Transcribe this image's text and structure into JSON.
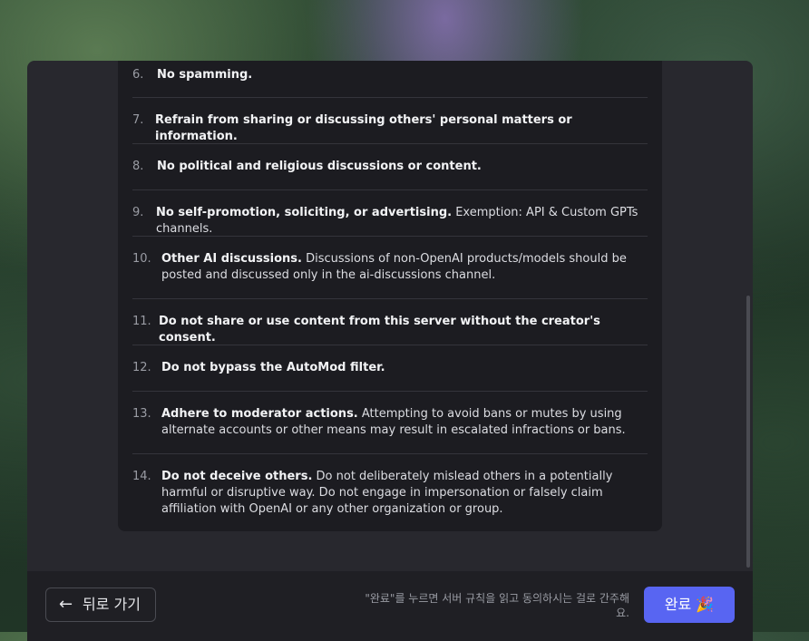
{
  "rules": [
    {
      "number": "6.",
      "title": "No spamming.",
      "body": ""
    },
    {
      "number": "7.",
      "title": "Refrain from sharing or discussing others' personal matters or information.",
      "body": ""
    },
    {
      "number": "8.",
      "title": "No political and religious discussions or content.",
      "body": ""
    },
    {
      "number": "9.",
      "title": "No self-promotion, soliciting, or advertising.",
      "body": " Exemption: API & Custom GPTs channels."
    },
    {
      "number": "10.",
      "title": "Other AI discussions.",
      "body": " Discussions of non-OpenAI products/models should be posted and discussed only in the ai-discussions channel."
    },
    {
      "number": "11.",
      "title": "Do not share or use content from this server without the creator's consent.",
      "body": ""
    },
    {
      "number": "12.",
      "title": "Do not bypass the AutoMod filter.",
      "body": ""
    },
    {
      "number": "13.",
      "title": "Adhere to moderator actions.",
      "body": " Attempting to avoid bans or mutes by using alternate accounts or other means may result in escalated infractions or bans."
    },
    {
      "number": "14.",
      "title": "Do not deceive others.",
      "body": " Do not deliberately mislead others in a potentially harmful or disruptive way. Do not engage in impersonation or falsely claim affiliation with OpenAI or any other organization or group."
    }
  ],
  "footer": {
    "back_label": "뒤로 가기",
    "back_icon": "arrow-left-icon",
    "hint": "\"완료\"를 누르면 서버 규칙을 읽고 동의하시는 걸로 간주해요.",
    "done_label": "완료 🎉"
  },
  "colors": {
    "accent": "#5865f2",
    "panel": "#1c1c21",
    "modal": "#28282e"
  }
}
